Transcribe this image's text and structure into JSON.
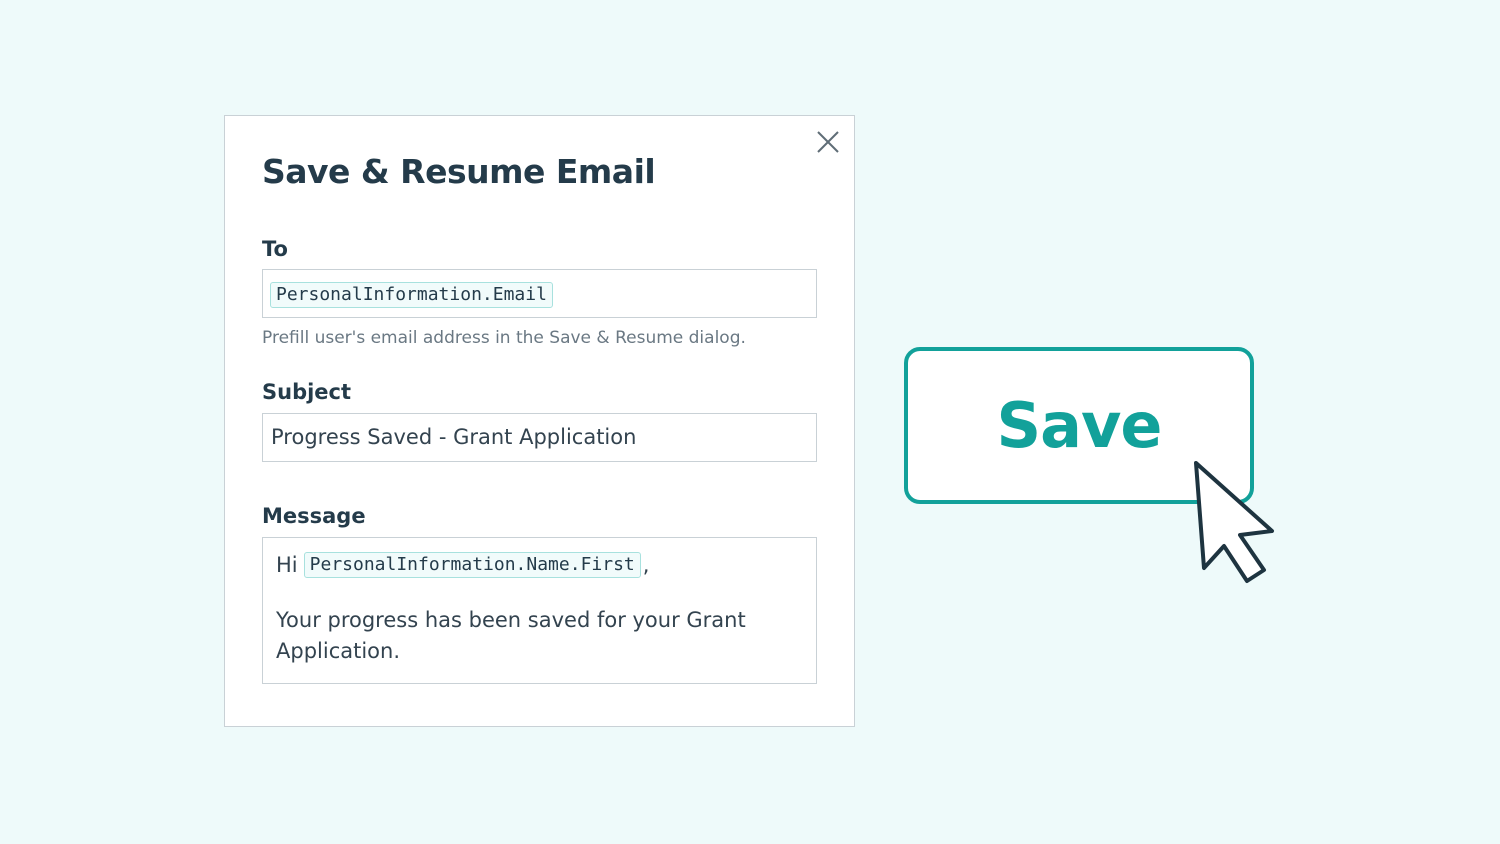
{
  "dialog": {
    "title": "Save & Resume Email",
    "close_icon": "close-icon",
    "to": {
      "label": "To",
      "token": "PersonalInformation.Email",
      "helper": "Prefill user's email address in the Save & Resume dialog."
    },
    "subject": {
      "label": "Subject",
      "value": "Progress Saved - Grant Application"
    },
    "message": {
      "label": "Message",
      "greeting": "Hi",
      "token": "PersonalInformation.Name.First",
      "after_token": ",",
      "body": "Your progress has been saved for your Grant Application."
    }
  },
  "save_button": {
    "label": "Save"
  },
  "cursor_icon": "arrow-cursor-icon",
  "colors": {
    "background": "#eefafa",
    "accent": "#12a19a",
    "text_dark": "#243b4a",
    "helper_text": "#6a7883",
    "token_border": "#a8e1de"
  }
}
